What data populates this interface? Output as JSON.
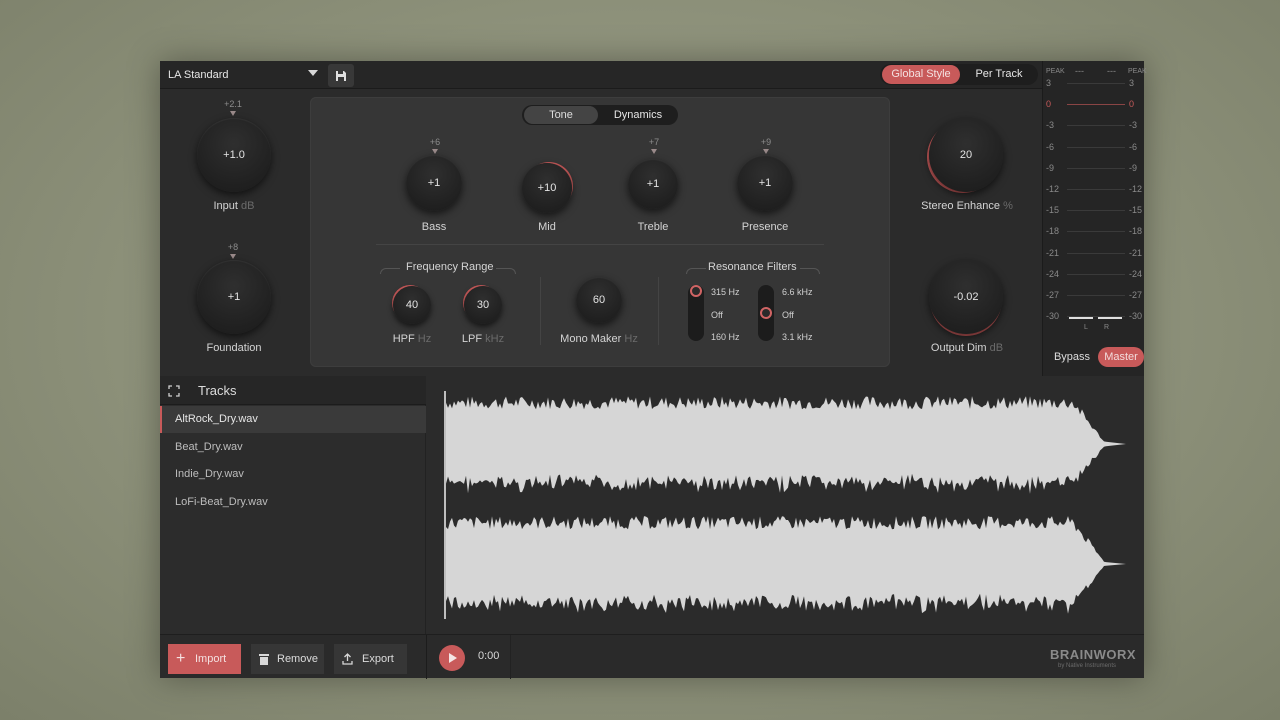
{
  "preset": {
    "name": "LA Standard"
  },
  "mode": {
    "global_style": "Global Style",
    "per_track": "Per Track"
  },
  "tabs": {
    "tone": "Tone",
    "dynamics": "Dynamics"
  },
  "knobs": {
    "input": {
      "label": "Input",
      "unit": "dB",
      "value": "+1.0",
      "marker": "+2.1"
    },
    "foundation": {
      "label": "Foundation",
      "value": "+1",
      "marker": "+8"
    },
    "bass": {
      "label": "Bass",
      "value": "+1",
      "marker": "+6"
    },
    "mid": {
      "label": "Mid",
      "value": "+10"
    },
    "treble": {
      "label": "Treble",
      "value": "+1",
      "marker": "+7"
    },
    "presence": {
      "label": "Presence",
      "value": "+1",
      "marker": "+9"
    },
    "stereo_enhance": {
      "label": "Stereo Enhance",
      "unit": "%",
      "value": "20"
    },
    "output_dim": {
      "label": "Output Dim",
      "unit": "dB",
      "value": "-0.02"
    },
    "hpf": {
      "label": "HPF",
      "unit": "Hz",
      "value": "40"
    },
    "lpf": {
      "label": "LPF",
      "unit": "kHz",
      "value": "30"
    },
    "mono_maker": {
      "label": "Mono Maker",
      "unit": "Hz",
      "value": "60"
    }
  },
  "sections": {
    "frequency_range": "Frequency Range",
    "resonance_filters": "Resonance Filters"
  },
  "resonance": {
    "left": {
      "top": "315 Hz",
      "mid": "Off",
      "bottom": "160 Hz"
    },
    "right": {
      "top": "6.6 kHz",
      "mid": "Off",
      "bottom": "3.1 kHz"
    }
  },
  "meter": {
    "peak_label": "PEAK",
    "peak_left": "---",
    "peak_right": "---",
    "scale": [
      "3",
      "0",
      "-3",
      "-6",
      "-9",
      "-12",
      "-15",
      "-18",
      "-21",
      "-24",
      "-27",
      "-30"
    ],
    "channel_l": "L",
    "channel_r": "R"
  },
  "footer_modes": {
    "bypass": "Bypass",
    "master": "Master"
  },
  "tracks": {
    "title": "Tracks",
    "items": [
      "AltRock_Dry.wav",
      "Beat_Dry.wav",
      "Indie_Dry.wav",
      "LoFi-Beat_Dry.wav"
    ]
  },
  "actions": {
    "import": "Import",
    "remove": "Remove",
    "export": "Export"
  },
  "transport": {
    "time": "0:00"
  },
  "brand": {
    "name": "BRAINWORX",
    "sub": "by Native Instruments"
  },
  "colors": {
    "accent": "#c85a5a",
    "panel": "#2c2c2c",
    "knob": "#1f1f1f"
  }
}
